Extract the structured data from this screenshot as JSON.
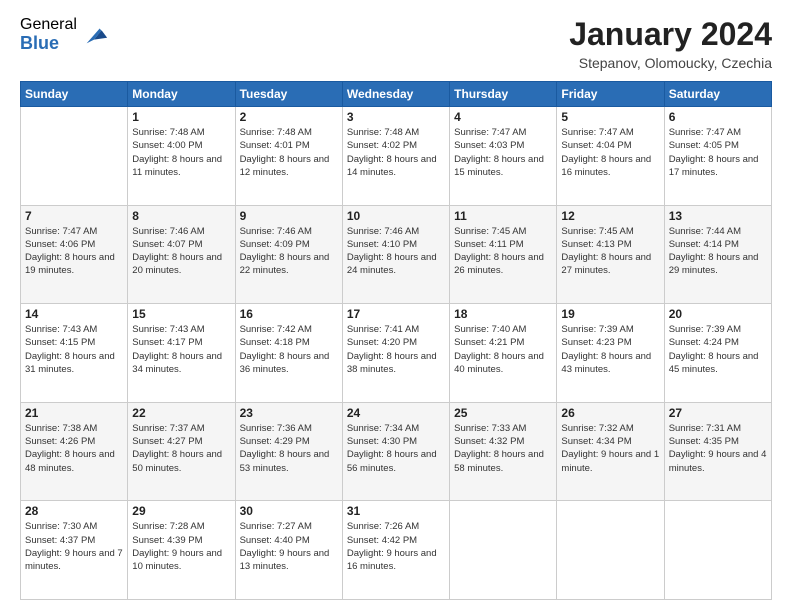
{
  "logo": {
    "general": "General",
    "blue": "Blue"
  },
  "header": {
    "month": "January 2024",
    "location": "Stepanov, Olomoucky, Czechia"
  },
  "weekdays": [
    "Sunday",
    "Monday",
    "Tuesday",
    "Wednesday",
    "Thursday",
    "Friday",
    "Saturday"
  ],
  "weeks": [
    [
      {
        "day": "",
        "sunrise": "",
        "sunset": "",
        "daylight": ""
      },
      {
        "day": "1",
        "sunrise": "Sunrise: 7:48 AM",
        "sunset": "Sunset: 4:00 PM",
        "daylight": "Daylight: 8 hours and 11 minutes."
      },
      {
        "day": "2",
        "sunrise": "Sunrise: 7:48 AM",
        "sunset": "Sunset: 4:01 PM",
        "daylight": "Daylight: 8 hours and 12 minutes."
      },
      {
        "day": "3",
        "sunrise": "Sunrise: 7:48 AM",
        "sunset": "Sunset: 4:02 PM",
        "daylight": "Daylight: 8 hours and 14 minutes."
      },
      {
        "day": "4",
        "sunrise": "Sunrise: 7:47 AM",
        "sunset": "Sunset: 4:03 PM",
        "daylight": "Daylight: 8 hours and 15 minutes."
      },
      {
        "day": "5",
        "sunrise": "Sunrise: 7:47 AM",
        "sunset": "Sunset: 4:04 PM",
        "daylight": "Daylight: 8 hours and 16 minutes."
      },
      {
        "day": "6",
        "sunrise": "Sunrise: 7:47 AM",
        "sunset": "Sunset: 4:05 PM",
        "daylight": "Daylight: 8 hours and 17 minutes."
      }
    ],
    [
      {
        "day": "7",
        "sunrise": "Sunrise: 7:47 AM",
        "sunset": "Sunset: 4:06 PM",
        "daylight": "Daylight: 8 hours and 19 minutes."
      },
      {
        "day": "8",
        "sunrise": "Sunrise: 7:46 AM",
        "sunset": "Sunset: 4:07 PM",
        "daylight": "Daylight: 8 hours and 20 minutes."
      },
      {
        "day": "9",
        "sunrise": "Sunrise: 7:46 AM",
        "sunset": "Sunset: 4:09 PM",
        "daylight": "Daylight: 8 hours and 22 minutes."
      },
      {
        "day": "10",
        "sunrise": "Sunrise: 7:46 AM",
        "sunset": "Sunset: 4:10 PM",
        "daylight": "Daylight: 8 hours and 24 minutes."
      },
      {
        "day": "11",
        "sunrise": "Sunrise: 7:45 AM",
        "sunset": "Sunset: 4:11 PM",
        "daylight": "Daylight: 8 hours and 26 minutes."
      },
      {
        "day": "12",
        "sunrise": "Sunrise: 7:45 AM",
        "sunset": "Sunset: 4:13 PM",
        "daylight": "Daylight: 8 hours and 27 minutes."
      },
      {
        "day": "13",
        "sunrise": "Sunrise: 7:44 AM",
        "sunset": "Sunset: 4:14 PM",
        "daylight": "Daylight: 8 hours and 29 minutes."
      }
    ],
    [
      {
        "day": "14",
        "sunrise": "Sunrise: 7:43 AM",
        "sunset": "Sunset: 4:15 PM",
        "daylight": "Daylight: 8 hours and 31 minutes."
      },
      {
        "day": "15",
        "sunrise": "Sunrise: 7:43 AM",
        "sunset": "Sunset: 4:17 PM",
        "daylight": "Daylight: 8 hours and 34 minutes."
      },
      {
        "day": "16",
        "sunrise": "Sunrise: 7:42 AM",
        "sunset": "Sunset: 4:18 PM",
        "daylight": "Daylight: 8 hours and 36 minutes."
      },
      {
        "day": "17",
        "sunrise": "Sunrise: 7:41 AM",
        "sunset": "Sunset: 4:20 PM",
        "daylight": "Daylight: 8 hours and 38 minutes."
      },
      {
        "day": "18",
        "sunrise": "Sunrise: 7:40 AM",
        "sunset": "Sunset: 4:21 PM",
        "daylight": "Daylight: 8 hours and 40 minutes."
      },
      {
        "day": "19",
        "sunrise": "Sunrise: 7:39 AM",
        "sunset": "Sunset: 4:23 PM",
        "daylight": "Daylight: 8 hours and 43 minutes."
      },
      {
        "day": "20",
        "sunrise": "Sunrise: 7:39 AM",
        "sunset": "Sunset: 4:24 PM",
        "daylight": "Daylight: 8 hours and 45 minutes."
      }
    ],
    [
      {
        "day": "21",
        "sunrise": "Sunrise: 7:38 AM",
        "sunset": "Sunset: 4:26 PM",
        "daylight": "Daylight: 8 hours and 48 minutes."
      },
      {
        "day": "22",
        "sunrise": "Sunrise: 7:37 AM",
        "sunset": "Sunset: 4:27 PM",
        "daylight": "Daylight: 8 hours and 50 minutes."
      },
      {
        "day": "23",
        "sunrise": "Sunrise: 7:36 AM",
        "sunset": "Sunset: 4:29 PM",
        "daylight": "Daylight: 8 hours and 53 minutes."
      },
      {
        "day": "24",
        "sunrise": "Sunrise: 7:34 AM",
        "sunset": "Sunset: 4:30 PM",
        "daylight": "Daylight: 8 hours and 56 minutes."
      },
      {
        "day": "25",
        "sunrise": "Sunrise: 7:33 AM",
        "sunset": "Sunset: 4:32 PM",
        "daylight": "Daylight: 8 hours and 58 minutes."
      },
      {
        "day": "26",
        "sunrise": "Sunrise: 7:32 AM",
        "sunset": "Sunset: 4:34 PM",
        "daylight": "Daylight: 9 hours and 1 minute."
      },
      {
        "day": "27",
        "sunrise": "Sunrise: 7:31 AM",
        "sunset": "Sunset: 4:35 PM",
        "daylight": "Daylight: 9 hours and 4 minutes."
      }
    ],
    [
      {
        "day": "28",
        "sunrise": "Sunrise: 7:30 AM",
        "sunset": "Sunset: 4:37 PM",
        "daylight": "Daylight: 9 hours and 7 minutes."
      },
      {
        "day": "29",
        "sunrise": "Sunrise: 7:28 AM",
        "sunset": "Sunset: 4:39 PM",
        "daylight": "Daylight: 9 hours and 10 minutes."
      },
      {
        "day": "30",
        "sunrise": "Sunrise: 7:27 AM",
        "sunset": "Sunset: 4:40 PM",
        "daylight": "Daylight: 9 hours and 13 minutes."
      },
      {
        "day": "31",
        "sunrise": "Sunrise: 7:26 AM",
        "sunset": "Sunset: 4:42 PM",
        "daylight": "Daylight: 9 hours and 16 minutes."
      },
      {
        "day": "",
        "sunrise": "",
        "sunset": "",
        "daylight": ""
      },
      {
        "day": "",
        "sunrise": "",
        "sunset": "",
        "daylight": ""
      },
      {
        "day": "",
        "sunrise": "",
        "sunset": "",
        "daylight": ""
      }
    ]
  ]
}
